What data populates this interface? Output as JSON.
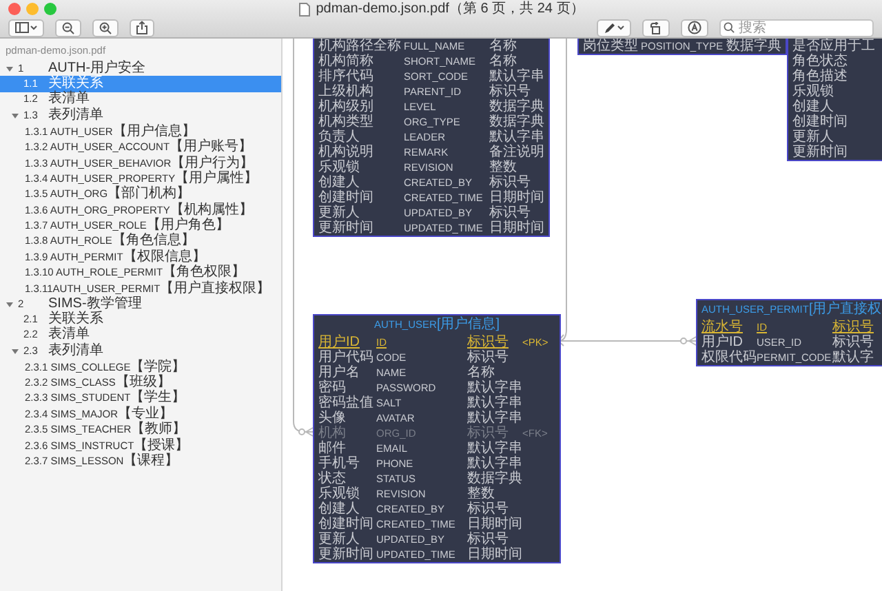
{
  "window": {
    "title": "pdman-demo.json.pdf（第 6 页，共 24 页）"
  },
  "toolbar": {
    "search": {
      "placeholder": "搜索"
    }
  },
  "sidebar": {
    "file": "pdman-demo.json.pdf",
    "items": [
      {
        "number": "1",
        "label": "AUTH-用户安全",
        "selected": false,
        "expanded": true,
        "children": [
          {
            "number": "1.1",
            "label": "关联关系",
            "selected": true
          },
          {
            "number": "1.2",
            "label": "表清单",
            "selected": false
          },
          {
            "number": "1.3",
            "label": "表列清单",
            "selected": false,
            "expanded": true,
            "children": [
              {
                "code": "1.3.1 AUTH_USER",
                "cn": "【用户信息】",
                "selected": false
              },
              {
                "code": "1.3.2 AUTH_USER_ACCOUNT",
                "cn": "【用户账号】",
                "selected": false
              },
              {
                "code": "1.3.3 AUTH_USER_BEHAVIOR",
                "cn": "【用户行为】",
                "selected": false
              },
              {
                "code": "1.3.4 AUTH_USER_PROPERTY",
                "cn": "【用户属性】",
                "selected": false
              },
              {
                "code": "1.3.5 AUTH_ORG",
                "cn": "【部门机构】",
                "selected": false
              },
              {
                "code": "1.3.6 AUTH_ORG_PROPERTY",
                "cn": "【机构属性】",
                "selected": false
              },
              {
                "code": "1.3.7 AUTH_USER_ROLE",
                "cn": "【用户角色】",
                "selected": false
              },
              {
                "code": "1.3.8 AUTH_ROLE",
                "cn": "【角色信息】",
                "selected": false
              },
              {
                "code": "1.3.9 AUTH_PERMIT",
                "cn": "【权限信息】",
                "selected": false
              },
              {
                "code": "1.3.10 AUTH_ROLE_PERMIT",
                "cn": "【角色权限】",
                "selected": false
              },
              {
                "code": "1.3.11AUTH_USER_PERMIT",
                "cn": "【用户直接权限】",
                "selected": false
              }
            ]
          }
        ]
      },
      {
        "number": "2",
        "label": "SIMS-教学管理",
        "selected": false,
        "expanded": true,
        "children": [
          {
            "number": "2.1",
            "label": "关联关系",
            "selected": false
          },
          {
            "number": "2.2",
            "label": "表清单",
            "selected": false
          },
          {
            "number": "2.3",
            "label": "表列清单",
            "selected": false,
            "expanded": true,
            "children": [
              {
                "code": "2.3.1 SIMS_COLLEGE",
                "cn": "【学院】",
                "selected": false
              },
              {
                "code": "2.3.2 SIMS_CLASS",
                "cn": "【班级】",
                "selected": false
              },
              {
                "code": "2.3.3 SIMS_STUDENT",
                "cn": "【学生】",
                "selected": false
              },
              {
                "code": "2.3.4 SIMS_MAJOR",
                "cn": "【专业】",
                "selected": false
              },
              {
                "code": "2.3.5 SIMS_TEACHER",
                "cn": "【教师】",
                "selected": false
              },
              {
                "code": "2.3.6 SIMS_INSTRUCT",
                "cn": "【授课】",
                "selected": false
              },
              {
                "code": "2.3.7 SIMS_LESSON",
                "cn": "【课程】",
                "selected": false
              }
            ]
          }
        ]
      }
    ]
  },
  "diagram": {
    "entities": [
      {
        "rows": [
          {
            "kind": "field",
            "cells": [
              "机构路径全称",
              "FULL_NAME",
              "名称"
            ]
          },
          {
            "kind": "field",
            "cells": [
              "机构简称",
              "SHORT_NAME",
              "名称"
            ]
          },
          {
            "kind": "field",
            "cells": [
              "排序代码",
              "SORT_CODE",
              "默认字串"
            ]
          },
          {
            "kind": "field",
            "cells": [
              "上级机构",
              "PARENT_ID",
              "标识号"
            ]
          },
          {
            "kind": "field",
            "cells": [
              "机构级别",
              "LEVEL",
              "数据字典"
            ]
          },
          {
            "kind": "field",
            "cells": [
              "机构类型",
              "ORG_TYPE",
              "数据字典"
            ]
          },
          {
            "kind": "field",
            "cells": [
              "负责人",
              "LEADER",
              "默认字串"
            ]
          },
          {
            "kind": "field",
            "cells": [
              "机构说明",
              "REMARK",
              "备注说明"
            ]
          },
          {
            "kind": "field",
            "cells": [
              "乐观锁",
              "REVISION",
              "整数"
            ]
          },
          {
            "kind": "field",
            "cells": [
              "创建人",
              "CREATED_BY",
              "标识号"
            ]
          },
          {
            "kind": "field",
            "cells": [
              "创建时间",
              "CREATED_TIME",
              "日期时间"
            ]
          },
          {
            "kind": "field",
            "cells": [
              "更新人",
              "UPDATED_BY",
              "标识号"
            ]
          },
          {
            "kind": "field",
            "cells": [
              "更新时间",
              "UPDATED_TIME",
              "日期时间"
            ]
          }
        ]
      },
      {
        "rows": [
          {
            "kind": "field",
            "cells": [
              "岗位类型",
              "POSITION_TYPE",
              "数据字典"
            ]
          }
        ]
      },
      {
        "rows": [
          {
            "kind": "field",
            "cells": [
              "是否应用于工"
            ]
          },
          {
            "kind": "field",
            "cells": [
              "角色状态"
            ]
          },
          {
            "kind": "field",
            "cells": [
              "角色描述"
            ]
          },
          {
            "kind": "field",
            "cells": [
              "乐观锁"
            ]
          },
          {
            "kind": "field",
            "cells": [
              "创建人"
            ]
          },
          {
            "kind": "field",
            "cells": [
              "创建时间"
            ]
          },
          {
            "kind": "field",
            "cells": [
              "更新人"
            ]
          },
          {
            "kind": "field",
            "cells": [
              "更新时间"
            ]
          }
        ]
      },
      {
        "title": {
          "code": "AUTH_USER",
          "cn": "[用户信息]"
        },
        "rows": [
          {
            "kind": "pk",
            "cells": [
              "用户ID",
              "ID",
              "标识号"
            ],
            "key": "<PK>"
          },
          {
            "kind": "field",
            "cells": [
              "用户代码",
              "CODE",
              "标识号"
            ]
          },
          {
            "kind": "field",
            "cells": [
              "用户名",
              "NAME",
              "名称"
            ]
          },
          {
            "kind": "field",
            "cells": [
              "密码",
              "PASSWORD",
              "默认字串"
            ]
          },
          {
            "kind": "field",
            "cells": [
              "密码盐值",
              "SALT",
              "默认字串"
            ]
          },
          {
            "kind": "field",
            "cells": [
              "头像",
              "AVATAR",
              "默认字串"
            ]
          },
          {
            "kind": "fk",
            "cells": [
              "机构",
              "ORG_ID",
              "标识号"
            ],
            "key": "<FK>"
          },
          {
            "kind": "field",
            "cells": [
              "邮件",
              "EMAIL",
              "默认字串"
            ]
          },
          {
            "kind": "field",
            "cells": [
              "手机号",
              "PHONE",
              "默认字串"
            ]
          },
          {
            "kind": "field",
            "cells": [
              "状态",
              "STATUS",
              "数据字典"
            ]
          },
          {
            "kind": "field",
            "cells": [
              "乐观锁",
              "REVISION",
              "整数"
            ]
          },
          {
            "kind": "field",
            "cells": [
              "创建人",
              "CREATED_BY",
              "标识号"
            ]
          },
          {
            "kind": "field",
            "cells": [
              "创建时间",
              "CREATED_TIME",
              "日期时间"
            ]
          },
          {
            "kind": "field",
            "cells": [
              "更新人",
              "UPDATED_BY",
              "标识号"
            ]
          },
          {
            "kind": "field",
            "cells": [
              "更新时间",
              "UPDATED_TIME",
              "日期时间"
            ]
          }
        ]
      },
      {
        "title": {
          "code": "AUTH_USER_PERMIT",
          "cn": "[用户直接权"
        },
        "rows": [
          {
            "kind": "pk",
            "cells": [
              "流水号",
              "ID",
              "标识号"
            ]
          },
          {
            "kind": "field",
            "cells": [
              "用户ID",
              "USER_ID",
              "标识号"
            ]
          },
          {
            "kind": "field",
            "cells": [
              "权限代码",
              "PERMIT_CODE",
              "默认字"
            ]
          }
        ]
      }
    ]
  }
}
